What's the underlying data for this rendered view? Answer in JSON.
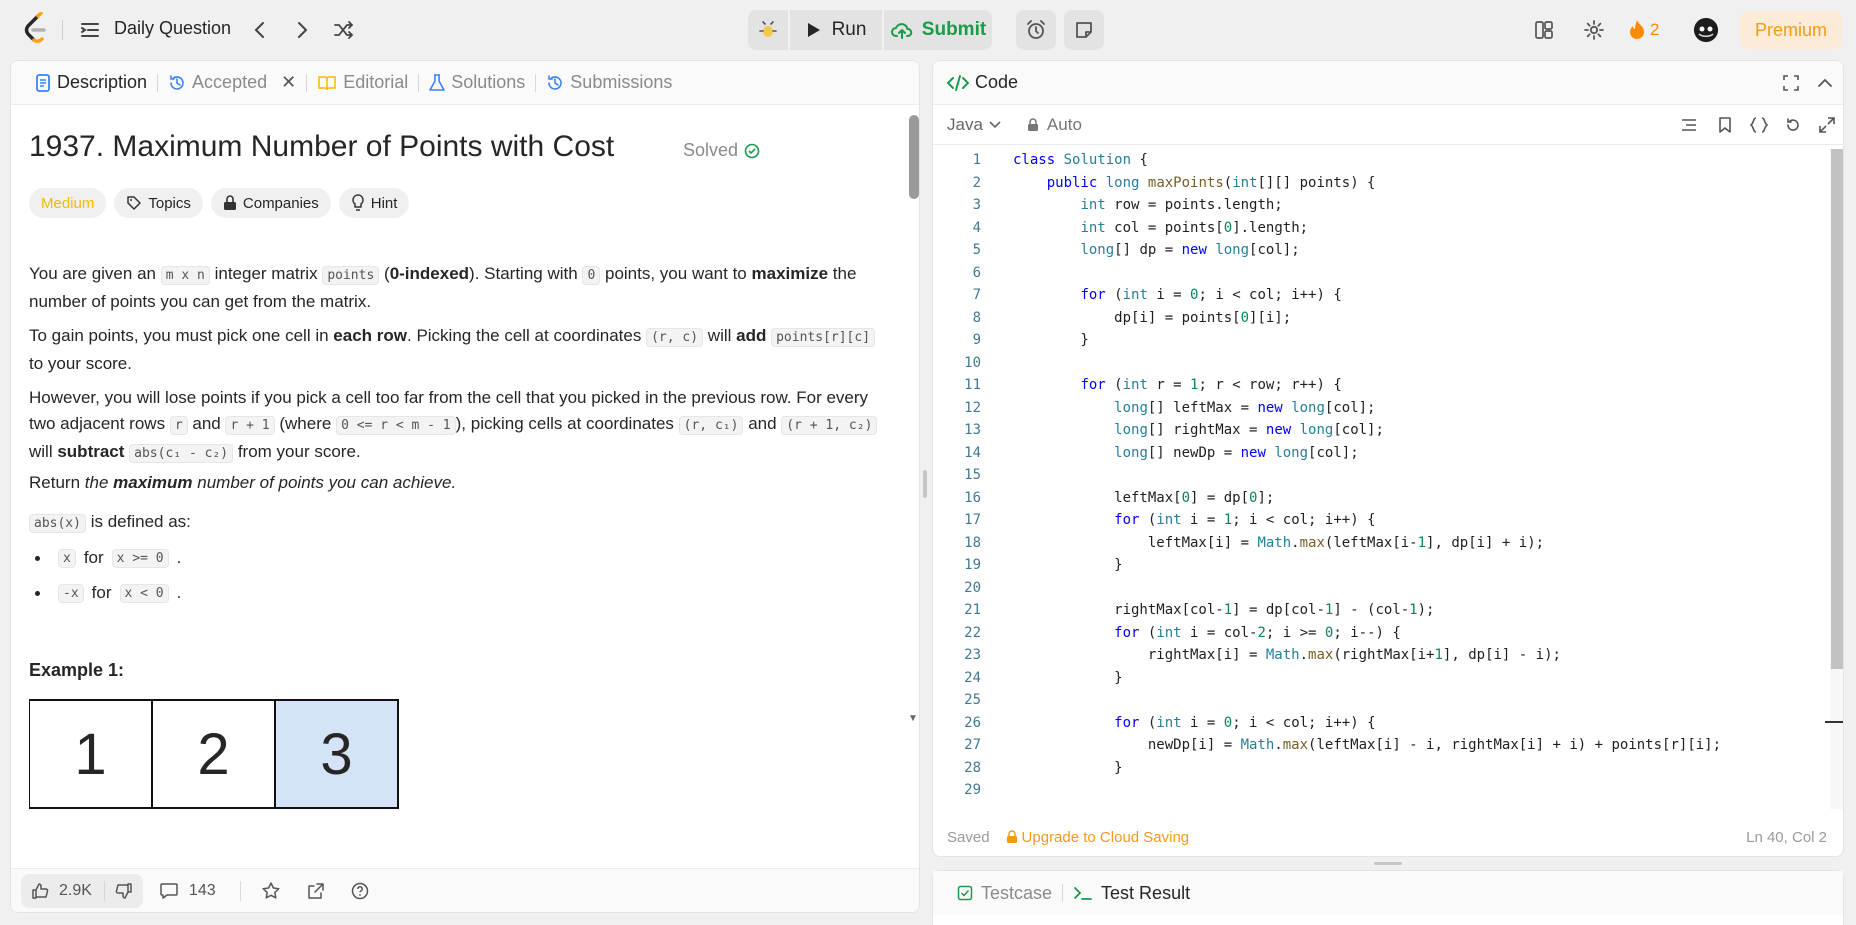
{
  "topbar": {
    "title": "Daily Question",
    "run_label": "Run",
    "submit_label": "Submit",
    "streak_count": "2",
    "premium_label": "Premium"
  },
  "left": {
    "tabs": [
      {
        "label": "Description",
        "icon": "document-icon"
      },
      {
        "label": "Accepted",
        "icon": "history-icon"
      },
      {
        "label": "Editorial",
        "icon": "book-icon"
      },
      {
        "label": "Solutions",
        "icon": "flask-icon"
      },
      {
        "label": "Submissions",
        "icon": "history-icon"
      }
    ],
    "problem_title": "1937. Maximum Number of Points with Cost",
    "solved_label": "Solved",
    "chips": [
      "Medium",
      "Topics",
      "Companies",
      "Hint"
    ],
    "example_title": "Example 1:",
    "grid": [
      "1",
      "2",
      "3"
    ],
    "likes": "2.9K",
    "comments": "143"
  },
  "code": {
    "header": "Code",
    "language": "Java",
    "auto_label": "Auto",
    "saved_label": "Saved",
    "upgrade_label": "Upgrade to Cloud Saving",
    "cursor_pos": "Ln 40, Col 2",
    "lines": [
      "class Solution {",
      "    public long maxPoints(int[][] points) {",
      "        int row = points.length;",
      "        int col = points[0].length;",
      "        long[] dp = new long[col];",
      "",
      "        for (int i = 0; i < col; i++) {",
      "            dp[i] = points[0][i];",
      "        }",
      "",
      "        for (int r = 1; r < row; r++) {",
      "            long[] leftMax = new long[col];",
      "            long[] rightMax = new long[col];",
      "            long[] newDp = new long[col];",
      "",
      "            leftMax[0] = dp[0];",
      "            for (int i = 1; i < col; i++) {",
      "                leftMax[i] = Math.max(leftMax[i-1], dp[i] + i);",
      "            }",
      "",
      "            rightMax[col-1] = dp[col-1] - (col-1);",
      "            for (int i = col-2; i >= 0; i--) {",
      "                rightMax[i] = Math.max(rightMax[i+1], dp[i] - i);",
      "            }",
      "",
      "            for (int i = 0; i < col; i++) {",
      "                newDp[i] = Math.max(leftMax[i] - i, rightMax[i] + i) + points[r][i];",
      "            }",
      ""
    ]
  },
  "test": {
    "tabs": [
      "Testcase",
      "Test Result"
    ]
  },
  "colors": {
    "accent_green": "#1a9b49",
    "premium_orange": "#f59a17",
    "medium_yellow": "#ffb800",
    "highlight_cell": "#d4e3f7"
  },
  "text": {
    "p1": {
      "t1": "You are given an",
      "c1": "m x n",
      "t2": "integer matrix",
      "c2": "points",
      "t3": "(",
      "b1": "0-indexed",
      "t4": "). Starting with",
      "c3": "0",
      "t5": "points, you want to",
      "b2": "maximize",
      "t6": "the number of points you can get from the matrix."
    },
    "p2": {
      "t1": "To gain points, you must pick one cell in",
      "b1": "each row",
      "t2": ". Picking the cell at coordinates",
      "c1": "(r, c)",
      "t3": "will",
      "b2": "add",
      "c2": "points[r][c]",
      "t4": "to your score."
    },
    "p3": {
      "t1": "However, you will lose points if you pick a cell too far from the cell that you picked in the previous row. For every two adjacent rows",
      "c1": "r",
      "t2": "and",
      "c2": "r + 1",
      "t3": "(where",
      "c3": "0 <= r < m - 1",
      "t4": "), picking cells at coordinates",
      "c4": "(r, c₁)",
      "t5": "and",
      "c5": "(r + 1, c₂)",
      "t6": "will",
      "b1": "subtract",
      "c6": "abs(c₁ - c₂)",
      "t7": "from your score."
    },
    "p4": {
      "t1": "Return",
      "i1": "the",
      "bi": "maximum",
      "i2": "number of points you can achieve."
    },
    "p5": {
      "c1": "abs(x)",
      "t1": "is defined as:"
    },
    "b1": {
      "c1": "x",
      "t1": "for",
      "c2": "x >= 0",
      "t2": "."
    },
    "b2": {
      "c1": "-x",
      "t1": "for",
      "c2": "x < 0",
      "t2": "."
    }
  }
}
